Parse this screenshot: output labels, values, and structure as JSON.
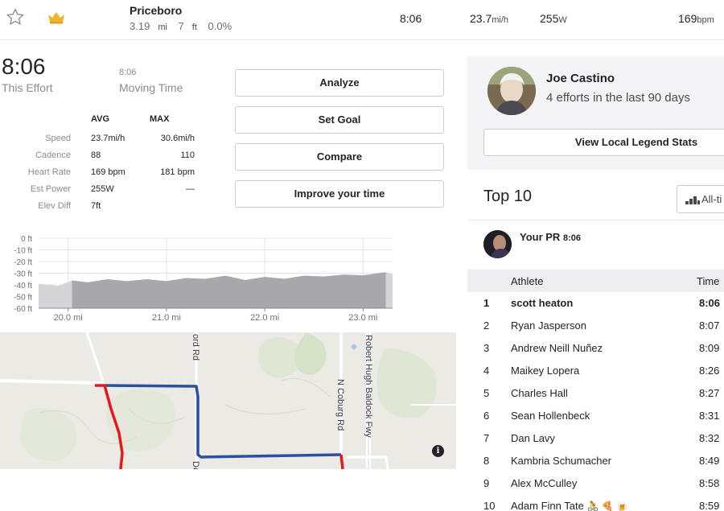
{
  "segment": {
    "name": "Priceboro",
    "distance": "3.19",
    "distance_unit": "mi",
    "elev_gain": "7",
    "elev_unit": "ft",
    "grade": "0.0%"
  },
  "top_stats": {
    "time": "8:06",
    "speed": "23.7",
    "speed_unit": "mi/h",
    "power": "255",
    "power_unit": "W",
    "hr": "169",
    "hr_unit": "bpm"
  },
  "effort": {
    "time": "8:06",
    "time_label": "This Effort",
    "moving_time": "8:06",
    "moving_label": "Moving Time"
  },
  "stats_table": {
    "avg_header": "AVG",
    "max_header": "MAX",
    "rows": [
      {
        "label": "Speed",
        "avg": "23.7mi/h",
        "max": "30.6mi/h"
      },
      {
        "label": "Cadence",
        "avg": "88",
        "max": "110"
      },
      {
        "label": "Heart Rate",
        "avg": "169 bpm",
        "max": "181 bpm"
      },
      {
        "label": "Est Power",
        "avg": "255W",
        "max": "—"
      },
      {
        "label": "Elev Diff",
        "avg": "7ft",
        "max": ""
      }
    ]
  },
  "actions": {
    "analyze": "Analyze",
    "set_goal": "Set Goal",
    "compare": "Compare",
    "improve": "Improve your time"
  },
  "elevation_chart": {
    "type": "area",
    "y_ticks": [
      "0 ft",
      "-10 ft",
      "-20 ft",
      "-30 ft",
      "-40 ft",
      "-50 ft",
      "-60 ft"
    ],
    "ylim": [
      -60,
      0
    ],
    "x_ticks": [
      "20.0 mi",
      "21.0 mi",
      "22.0 mi",
      "23.0 mi"
    ],
    "x_tick_values": [
      20.0,
      21.0,
      22.0,
      23.0
    ],
    "xlim": [
      19.7,
      23.3
    ],
    "highlight_range": [
      20.04,
      23.23
    ],
    "x": [
      19.7,
      19.9,
      20.04,
      20.2,
      20.4,
      20.6,
      20.8,
      21.0,
      21.2,
      21.4,
      21.6,
      21.8,
      22.0,
      22.2,
      22.4,
      22.6,
      22.8,
      23.0,
      23.23,
      23.3
    ],
    "values": [
      -40,
      -40,
      -37,
      -37,
      -36,
      -36,
      -36,
      -36,
      -35,
      -34,
      -33,
      -35,
      -34,
      -34,
      -33,
      -32,
      -32,
      -31,
      -30,
      -30
    ],
    "grid": true
  },
  "map": {
    "roads": [
      "N Coburg Rd",
      "Robert Hugh Baldock Fwy"
    ],
    "partial_labels": [
      "ord Rd",
      "De"
    ],
    "info": "i"
  },
  "local_legend": {
    "name": "Joe Castino",
    "subtitle": "4 efforts in the last 90 days",
    "button": "View Local Legend Stats"
  },
  "leaderboard": {
    "title": "Top 10",
    "filter": "All-ti",
    "pr_label": "Your PR",
    "pr_time": "8:06",
    "col_athlete": "Athlete",
    "col_time": "Time",
    "rows": [
      {
        "rank": "1",
        "name": "scott heaton",
        "time": "8:06"
      },
      {
        "rank": "2",
        "name": "Ryan Jasperson",
        "time": "8:07"
      },
      {
        "rank": "3",
        "name": "Andrew Neill Nuñez",
        "time": "8:09"
      },
      {
        "rank": "4",
        "name": "Maikey Lopera",
        "time": "8:26"
      },
      {
        "rank": "5",
        "name": "Charles Hall",
        "time": "8:27"
      },
      {
        "rank": "6",
        "name": "Sean Hollenbeck",
        "time": "8:31"
      },
      {
        "rank": "7",
        "name": "Dan Lavy",
        "time": "8:32"
      },
      {
        "rank": "8",
        "name": "Kambria Schumacher",
        "time": "8:49"
      },
      {
        "rank": "9",
        "name": "Alex McCulley",
        "time": "8:58"
      },
      {
        "rank": "10",
        "name": "Adam Finn Tate",
        "time": "8:59",
        "emoji": "🚴 🍕 🍺"
      }
    ]
  },
  "colors": {
    "route_blue": "#2a4fa3",
    "route_red": "#e8161b",
    "crown": "#f0b429"
  }
}
